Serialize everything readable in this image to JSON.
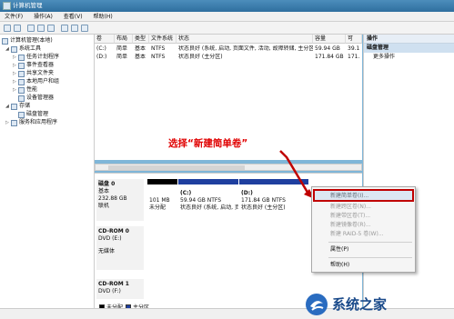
{
  "window": {
    "title": "计算机管理"
  },
  "menu": [
    "文件(F)",
    "操作(A)",
    "查看(V)",
    "帮助(H)"
  ],
  "tree": {
    "root": "计算机管理(本地)",
    "system_tools": "系统工具",
    "task_scheduler": "任务计划程序",
    "event_viewer": "事件查看器",
    "shared_folders": "共享文件夹",
    "local_users": "本地用户和组",
    "performance": "性能",
    "device_manager": "设备管理器",
    "storage": "存储",
    "disk_mgmt": "磁盘管理",
    "services": "服务和应用程序"
  },
  "volumes": {
    "columns": [
      "卷",
      "布局",
      "类型",
      "文件系统",
      "状态",
      "容量",
      "可"
    ],
    "rows": [
      [
        "(C:)",
        "简单",
        "基本",
        "NTFS",
        "状态良好 (系统, 启动, 页面文件, 活动, 故障转储, 主分区)",
        "59.94 GB",
        "39.1"
      ],
      [
        "(D:)",
        "简单",
        "基本",
        "NTFS",
        "状态良好 (主分区)",
        "171.84 GB",
        "171."
      ]
    ]
  },
  "disks": {
    "disk0": {
      "name": "磁盘 0",
      "type": "基本",
      "size": "232.88 GB",
      "status": "联机"
    },
    "unalloc": {
      "size": "101 MB",
      "label": "未分配"
    },
    "c": {
      "name": "(C:)",
      "size": "59.94 GB NTFS",
      "status": "状态良好 (系统, 启动, 页"
    },
    "d": {
      "name": "(D:)",
      "size": "171.84 GB NTFS",
      "status": "状态良好 (主分区)"
    },
    "cdrom0": {
      "name": "CD-ROM 0",
      "type": "DVD (E:)",
      "media": "无媒体"
    },
    "cdrom1": {
      "name": "CD-ROM 1",
      "type": "DVD (F:)"
    },
    "legend": {
      "unallocated": "未分配",
      "primary": "主分区"
    }
  },
  "actions": {
    "header": "操作",
    "section": "磁盘管理",
    "more": "更多操作"
  },
  "callout": "选择“新建简单卷”",
  "context_menu": {
    "new_simple": "新建简单卷(I)...",
    "new_spanned": "新建跨区卷(N)...",
    "new_striped": "新建带区卷(T)...",
    "new_mirror": "新建镜像卷(R)...",
    "new_raid5": "新建 RAID-5 卷(W)...",
    "properties": "属性(P)",
    "help": "帮助(H)"
  },
  "watermark": "系统之家",
  "colors": {
    "title": "#2f6f9f",
    "callout": "#e00000",
    "unalloc": "#000000",
    "primary": "#1f3f9f"
  }
}
